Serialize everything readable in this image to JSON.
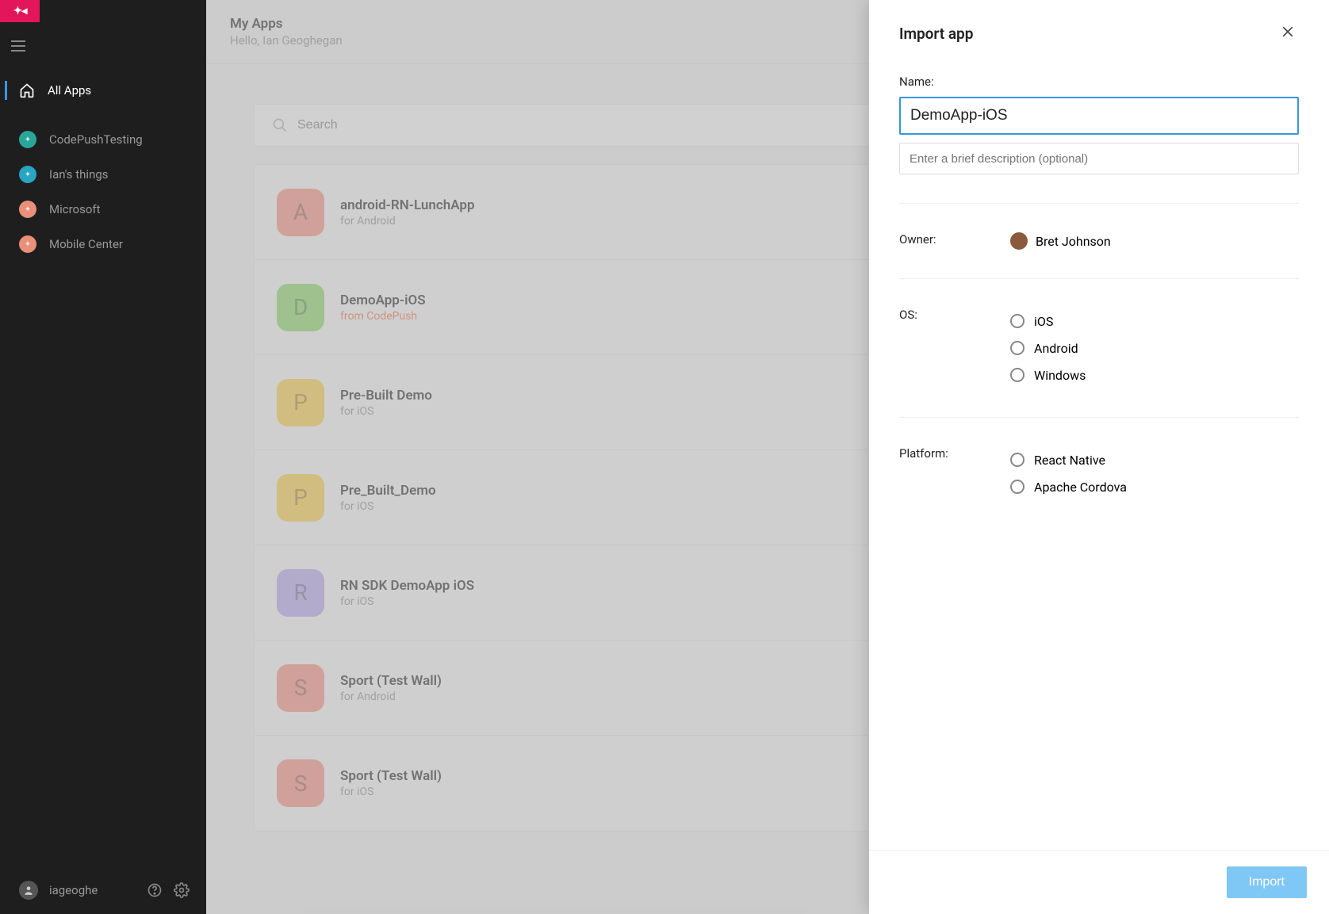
{
  "sidebar": {
    "nav_all_apps": "All Apps",
    "orgs": [
      {
        "name": "CodePushTesting",
        "color": "#2aa59a"
      },
      {
        "name": "Ian's things",
        "color": "#29a5c4"
      },
      {
        "name": "Microsoft",
        "color": "#e98f7a"
      },
      {
        "name": "Mobile Center",
        "color": "#e98f7a"
      }
    ],
    "footer_user": "iageoghe"
  },
  "header": {
    "title": "My Apps",
    "subtitle": "Hello, Ian Geoghegan"
  },
  "search": {
    "placeholder": "Search"
  },
  "apps": [
    {
      "letter": "A",
      "color": "#f08a7a",
      "name": "android-RN-LunchApp",
      "sub": "for Android",
      "accent": false
    },
    {
      "letter": "D",
      "color": "#86d05f",
      "name": "DemoApp-iOS",
      "sub": "from CodePush",
      "accent": true
    },
    {
      "letter": "P",
      "color": "#f5c842",
      "name": "Pre-Built Demo",
      "sub": "for iOS",
      "accent": false
    },
    {
      "letter": "P",
      "color": "#f5c842",
      "name": "Pre_Built_Demo",
      "sub": "for iOS",
      "accent": false
    },
    {
      "letter": "R",
      "color": "#b0a1e6",
      "name": "RN SDK DemoApp iOS",
      "sub": "for iOS",
      "accent": false
    },
    {
      "letter": "S",
      "color": "#f08a7a",
      "name": "Sport (Test Wall)",
      "sub": "for Android",
      "accent": false
    },
    {
      "letter": "S",
      "color": "#f08a7a",
      "name": "Sport (Test Wall)",
      "sub": "for iOS",
      "accent": false
    }
  ],
  "panel": {
    "title": "Import app",
    "name_label": "Name:",
    "name_value": "DemoApp-iOS",
    "desc_placeholder": "Enter a brief description (optional)",
    "owner_label": "Owner:",
    "owner_name": "Bret Johnson",
    "os_label": "OS:",
    "os_options": [
      "iOS",
      "Android",
      "Windows"
    ],
    "platform_label": "Platform:",
    "platform_options": [
      "React Native",
      "Apache Cordova"
    ],
    "import_button": "Import"
  }
}
